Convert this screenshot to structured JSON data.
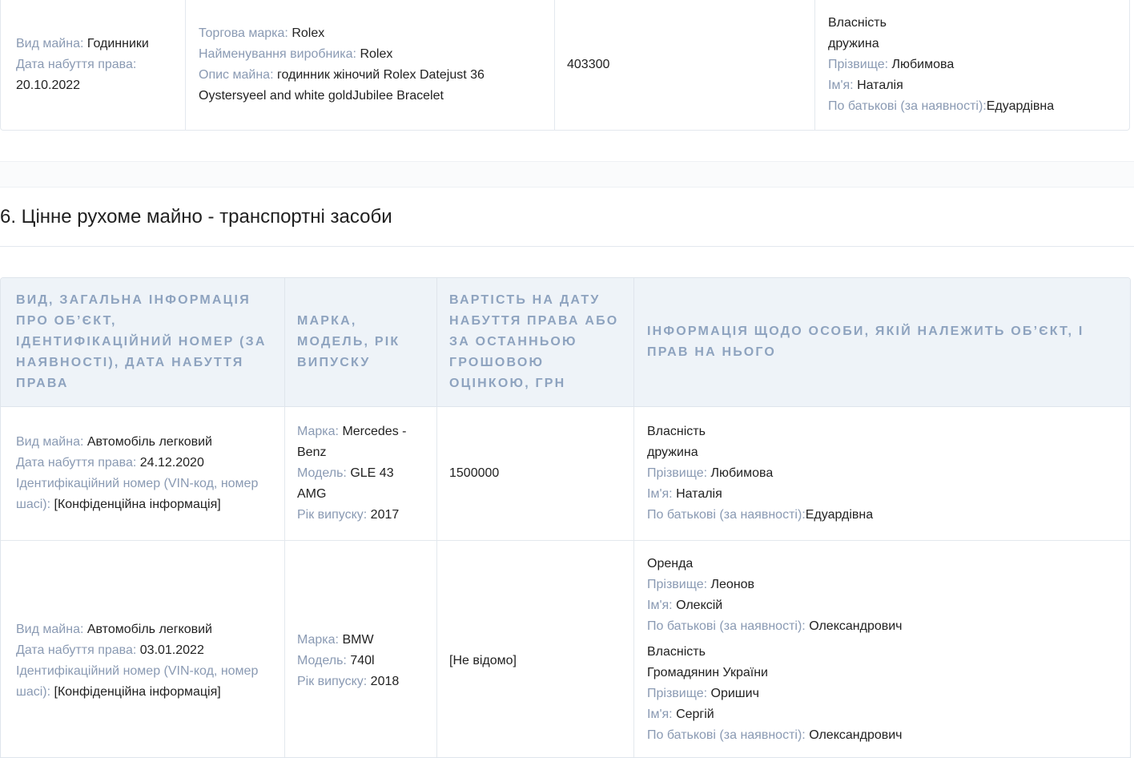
{
  "top_row": {
    "col1": [
      {
        "label": "Вид майна:",
        "value": "Годинники"
      },
      {
        "label": "Дата набуття права:",
        "value": "20.10.2022"
      }
    ],
    "col2": [
      {
        "label": "Торгова марка:",
        "value": "Rolex"
      },
      {
        "label": "Найменування виробника:",
        "value": "Rolex"
      },
      {
        "label": "Опис майна:",
        "value": "годинник жіночий Rolex Datejust 36 Oystersyeel and white goldJubilee Bracelet"
      }
    ],
    "col3": "403300",
    "col4": {
      "rights": "Власність",
      "relation": "дружина",
      "fields": [
        {
          "label": "Прізвище:",
          "value": "Любимова"
        },
        {
          "label": "Ім'я:",
          "value": "Наталія"
        },
        {
          "label": "По батькові (за наявності):",
          "value": "Едуардівна"
        }
      ]
    }
  },
  "section": {
    "title": "6. Цінне рухоме майно - транспортні засоби"
  },
  "table": {
    "headers": [
      "Вид, загальна інформація про об’єкт, ідентифікаційний номер (за наявності), дата набуття права",
      "Марка, модель, рік випуску",
      "Вартість на дату набуття права або за останньою грошовою оцінкою, грн",
      "Інформація щодо особи, якій належить об’єкт, і прав на нього"
    ],
    "rows": [
      {
        "col1": [
          {
            "label": "Вид майна:",
            "value": "Автомобіль легковий"
          },
          {
            "label": "Дата набуття права:",
            "value": "24.12.2020"
          },
          {
            "label": "Ідентифікаційний номер (VIN-код, номер шасі):",
            "value": "[Конфіденційна інформація]"
          }
        ],
        "col2": [
          {
            "label": "Марка:",
            "value": "Mercedes -Benz"
          },
          {
            "label": "Модель:",
            "value": "GLE 43 AMG"
          },
          {
            "label": "Рік випуску:",
            "value": "2017"
          }
        ],
        "col3": "1500000",
        "owners": [
          {
            "rights": "Власність",
            "relation": "дружина",
            "fields": [
              {
                "label": "Прізвище:",
                "value": "Любимова"
              },
              {
                "label": "Ім'я:",
                "value": "Наталія"
              },
              {
                "label": "По батькові (за наявності):",
                "value": "Едуардівна"
              }
            ]
          }
        ]
      },
      {
        "col1": [
          {
            "label": "Вид майна:",
            "value": "Автомобіль легковий"
          },
          {
            "label": "Дата набуття права:",
            "value": "03.01.2022"
          },
          {
            "label": "Ідентифікаційний номер (VIN-код, номер шасі):",
            "value": "[Конфіденційна інформація]"
          }
        ],
        "col2": [
          {
            "label": "Марка:",
            "value": "BMW"
          },
          {
            "label": "Модель:",
            "value": "740l"
          },
          {
            "label": "Рік випуску:",
            "value": "2018"
          }
        ],
        "col3": "[Не відомо]",
        "owners": [
          {
            "rights": "Оренда",
            "fields": [
              {
                "label": "Прізвище:",
                "value": "Леонов"
              },
              {
                "label": "Ім'я:",
                "value": "Олексій"
              },
              {
                "label": "По батькові (за наявності):",
                "value": "Олександрович"
              }
            ]
          },
          {
            "rights": "Власність",
            "relation": "Громадянин України",
            "fields": [
              {
                "label": "Прізвище:",
                "value": "Оришич"
              },
              {
                "label": "Ім'я:",
                "value": "Сергій"
              },
              {
                "label": "По батькові (за наявності):",
                "value": "Олександрович"
              }
            ]
          }
        ]
      }
    ]
  }
}
